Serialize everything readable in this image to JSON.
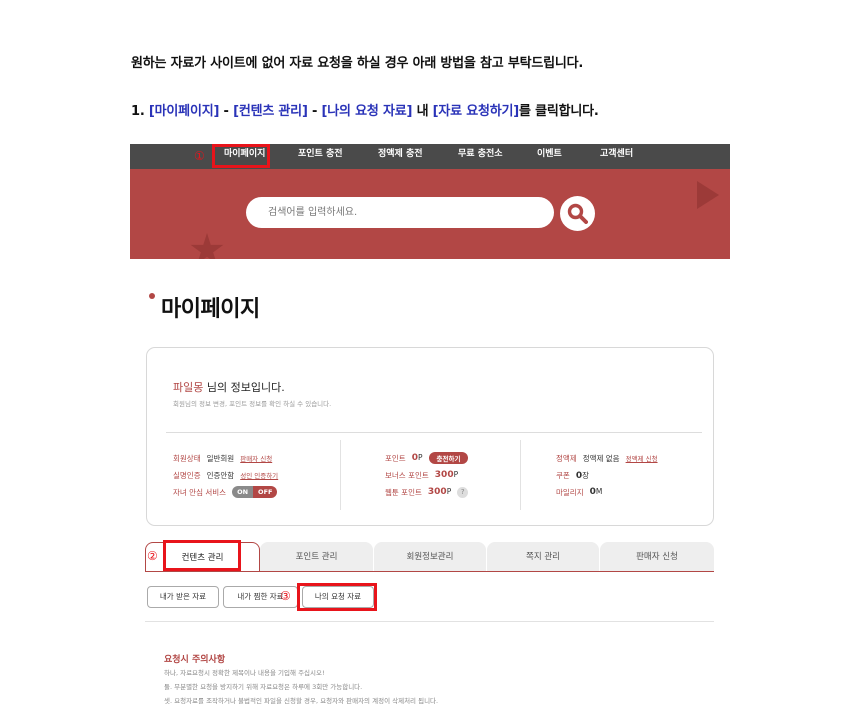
{
  "intro_text": "원하는 자료가 사이트에 없어 자료 요청을 하실 경우 아래 방법을 참고 부탁드립니다.",
  "step1": {
    "number": "1.",
    "path1": "[마이페이지]",
    "sep1": " - ",
    "path2": "[컨텐츠 관리]",
    "sep2": " - ",
    "path3": "[나의 요청 자료]",
    "mid": " 내 ",
    "button_ref": "[자료 요청하기]",
    "end": "를 클릭합니다."
  },
  "markers": {
    "m1": "①",
    "m2": "②",
    "m3": "③"
  },
  "nav": {
    "items": [
      "마이페이지",
      "포인트 충전",
      "정액제 충전",
      "무료 충전소",
      "이벤트",
      "고객센터"
    ]
  },
  "search": {
    "placeholder": "검색어를 입력하세요."
  },
  "page_title": "마이페이지",
  "info": {
    "user_name": "파일몽",
    "greet_suffix": " 님의 정보입니다.",
    "sub": "회원님의 정보 변경, 포인트 정보를 확인 하실 수 있습니다.",
    "col1": {
      "member_label": "회원상태",
      "member_value": "일반회원",
      "member_link": "판매자 신청",
      "verify_label": "실명인증",
      "verify_value": "인증안함",
      "verify_link": "성인 인증하기",
      "safe_label": "자녀 안심 서비스",
      "toggle_on": "ON",
      "toggle_off": "OFF"
    },
    "col2": {
      "point_label": "포인트",
      "point_value": "0",
      "point_unit": "P",
      "charge_btn": "충전하기",
      "bonus_label": "보너스 포인트",
      "bonus_value": "300",
      "bonus_unit": "P",
      "webtoon_label": "웹툰 포인트",
      "webtoon_value": "300",
      "webtoon_unit": "P",
      "help": "?"
    },
    "col3": {
      "flat_label": "정액제",
      "flat_value": "정액제 없음",
      "flat_link": "정액제 신청",
      "coupon_label": "쿠폰",
      "coupon_value": "0",
      "coupon_unit": "장",
      "mileage_label": "마일리지",
      "mileage_value": "0",
      "mileage_unit": "M"
    }
  },
  "tabs": [
    "컨텐츠 관리",
    "포인트 관리",
    "회원정보관리",
    "쪽지 관리",
    "판매자 신청"
  ],
  "subtabs": [
    "내가 받은 자료",
    "내가 찜한 자료",
    "나의 요청 자료"
  ],
  "notice": {
    "title": "요청시 주의사항",
    "lines": [
      "하나, 자료요청시 정확한 제목이나 내용을 기입해 주십시오!",
      "둘. 무분별한 요청을 방지하기 위해 자료요청은 하루에 3회만 가능합니다.",
      "셋. 요청자료를 조작하거나 불법적인 파일을 신청할 경우, 요청자와 판매자의 계정이 삭제처리 됩니다."
    ]
  },
  "colors": {
    "accent": "#b24745",
    "highlight": "#e8141b",
    "link_blue": "#2a33b8",
    "nav_bg": "#4a4a4a"
  }
}
